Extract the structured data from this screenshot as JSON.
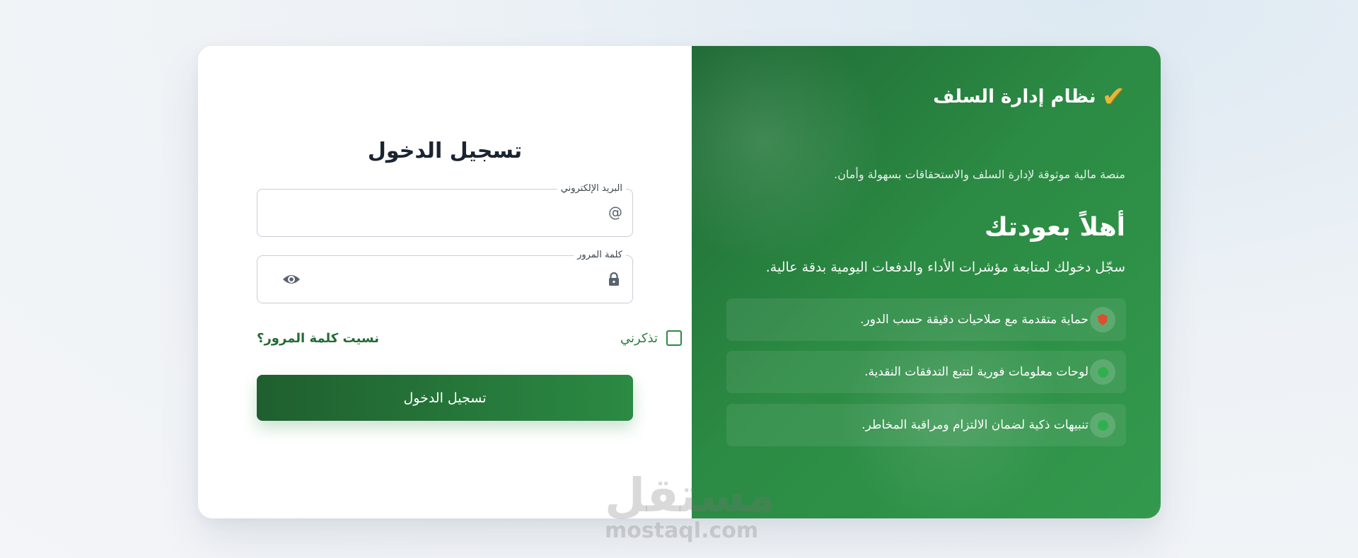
{
  "promo": {
    "brand_title": "نظام إدارة السلف",
    "brand_icon": "check-mark-icon",
    "brand_subtitle": "منصة مالية موثوقة لإدارة السلف والاستحقاقات بسهولة وأمان.",
    "welcome_title": "أهلاً بعودتك",
    "welcome_subtitle": "سجّل دخولك لمتابعة مؤشرات الأداء والدفعات اليومية بدقة عالية.",
    "features": [
      {
        "label": "حماية متقدمة مع صلاحيات دقيقة حسب الدور.",
        "icon": "shield-icon"
      },
      {
        "label": "لوحات معلومات فورية لتتبع التدفقات النقدية.",
        "icon": "green-dot-icon"
      },
      {
        "label": "تنبيهات ذكية لضمان الالتزام ومراقبة المخاطر.",
        "icon": "green-dot-icon"
      }
    ],
    "colors": {
      "panel_start": "#1f6a35",
      "panel_end": "#33994d",
      "brand_icon": "#e8b53c",
      "shield": "#d9502f"
    }
  },
  "login": {
    "title": "تسجيل الدخول",
    "email_label": "البريد الإلكتروني",
    "email_value": "",
    "password_label": "كلمة المرور",
    "password_value": "",
    "remember_label": "تذكرني",
    "remember_checked": false,
    "forgot_label": "نسيت كلمة المرور؟",
    "submit_label": "تسجيل الدخول",
    "colors": {
      "accent": "#2b8a43",
      "text": "#1b2431"
    }
  },
  "watermark": {
    "arabic": "مستقل",
    "latin": "mostaql.com"
  }
}
